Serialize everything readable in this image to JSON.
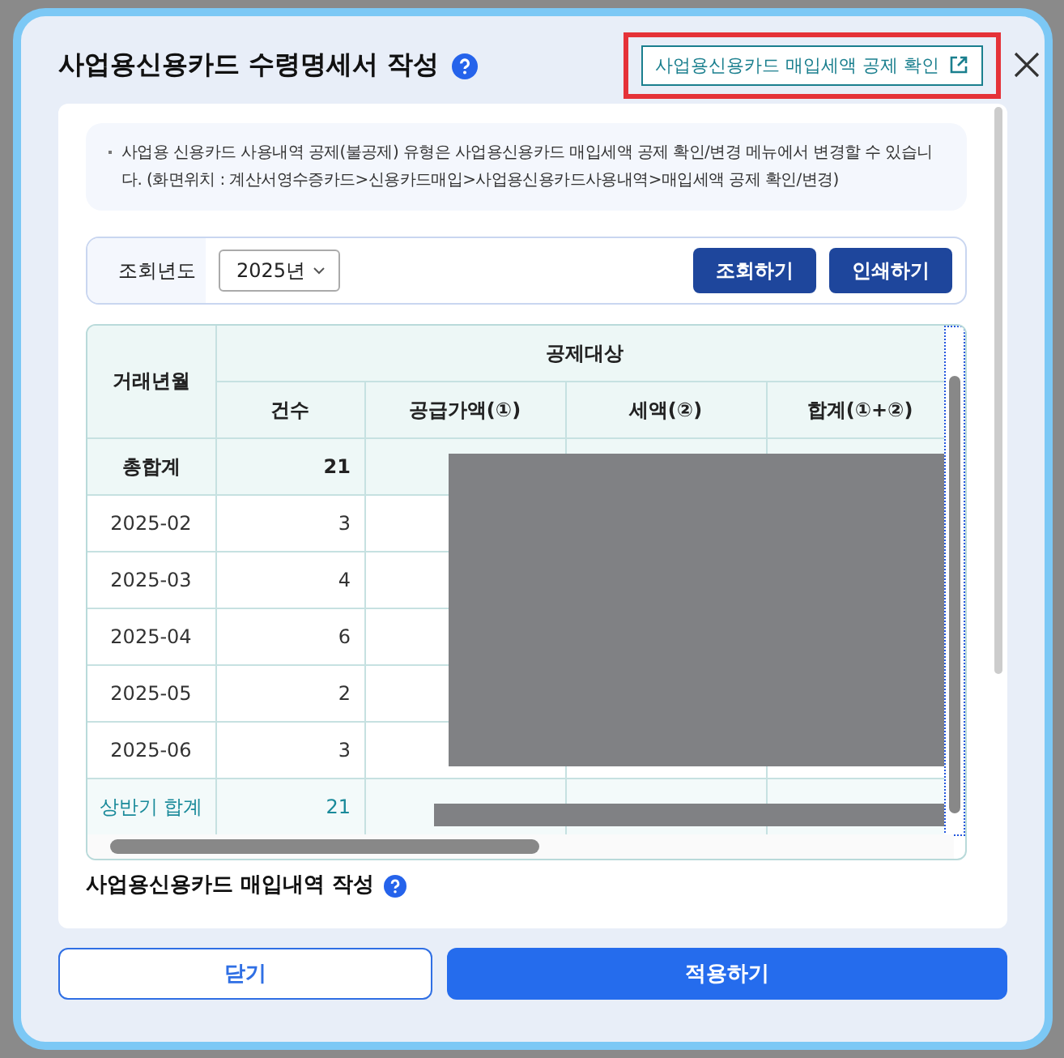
{
  "dialog": {
    "title": "사업용신용카드 수령명세서 작성",
    "link_button": {
      "label": "사업용신용카드 매입세액 공제 확인",
      "highlighted": true
    },
    "notice": "사업용 신용카드 사용내역 공제(불공제) 유형은 사업용신용카드 매입세액 공제 확인/변경 메뉴에서  변경할 수 있습니다. (화면위치 : 계산서영수증카드>신용카드매입>사업용신용카드사용내역>매입세액 공제 확인/변경)",
    "search": {
      "label": "조회년도",
      "year": "2025년",
      "buttons": [
        "조회하기",
        "인쇄하기"
      ]
    },
    "table": {
      "row_header": "거래년월",
      "group_header": "공제대상",
      "columns": [
        "건수",
        "공급가액(①)",
        "세액(②)",
        "합계(①+②)"
      ],
      "redacted": true,
      "rows": [
        {
          "month": "총합계",
          "count": "21",
          "kind": "grand_total"
        },
        {
          "month": "2025-02",
          "count": "3",
          "kind": "month"
        },
        {
          "month": "2025-03",
          "count": "4",
          "kind": "month"
        },
        {
          "month": "2025-04",
          "count": "6",
          "kind": "month"
        },
        {
          "month": "2025-05",
          "count": "2",
          "kind": "month"
        },
        {
          "month": "2025-06",
          "count": "3",
          "kind": "month"
        },
        {
          "month": "상반기 합계",
          "count": "21",
          "kind": "half_total"
        }
      ]
    },
    "section_heading": "사업용신용카드 매입내역 작성",
    "footer_buttons": [
      {
        "label": "닫기",
        "kind": "secondary"
      },
      {
        "label": "적용하기",
        "kind": "primary"
      }
    ]
  }
}
